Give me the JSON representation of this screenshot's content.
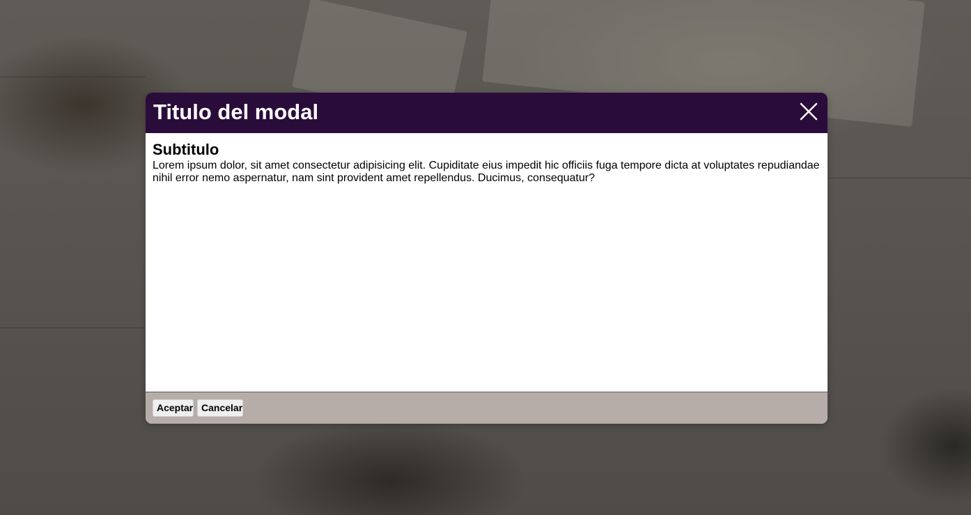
{
  "modal": {
    "title": "Titulo del modal",
    "close_icon": "close-icon",
    "subtitle": "Subtitulo",
    "body_text": "Lorem ipsum dolor, sit amet consectetur adipisicing elit. Cupiditate eius impedit hic officiis fuga tempore dicta at voluptates repudiandae nihil error nemo aspernatur, nam sint provident amet repellendus. Ducimus, consequatur?",
    "accept_label": "Aceptar",
    "cancel_label": "Cancelar"
  },
  "colors": {
    "header_background": "#2a0c3a",
    "footer_background": "#b6ada9",
    "overlay_dim": "#57544f"
  }
}
